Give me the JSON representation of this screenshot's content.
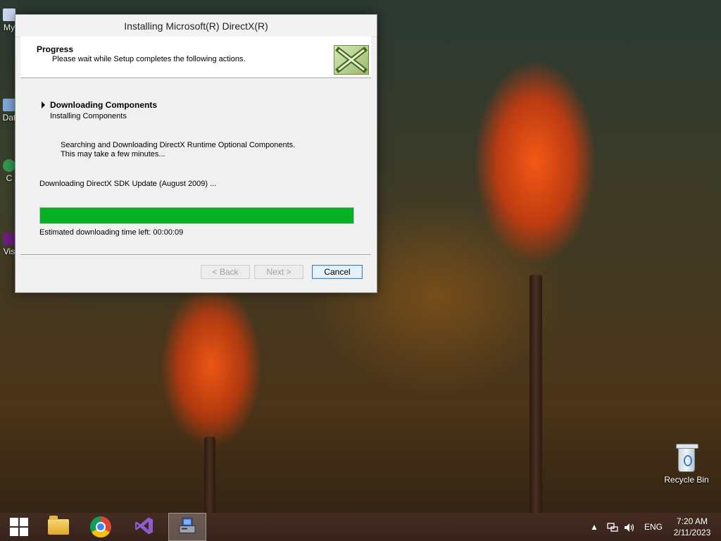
{
  "desktop": {
    "icons": [
      {
        "label": "My"
      },
      {
        "label": "Dat"
      },
      {
        "label": "C"
      },
      {
        "label": "Vis"
      }
    ],
    "recycle_bin_label": "Recycle Bin"
  },
  "dialog": {
    "title": "Installing Microsoft(R) DirectX(R)",
    "header_title": "Progress",
    "header_subtitle": "Please wait while Setup completes the following actions.",
    "step_title": "Downloading Components",
    "step_subtitle": "Installing Components",
    "detail_line1": "Searching and Downloading DirectX Runtime Optional Components.",
    "detail_line2": "This may take a few minutes...",
    "status": "Downloading DirectX SDK Update (August 2009) ...",
    "progress_percent": 100,
    "progress_color": "#06b025",
    "eta": "Estimated downloading time left: 00:00:09",
    "buttons": {
      "back": "< Back",
      "next": "Next >",
      "cancel": "Cancel"
    }
  },
  "taskbar": {
    "items": [
      "windows-start-icon",
      "file-explorer-icon",
      "chrome-icon",
      "visual-studio-icon",
      "setup-icon"
    ],
    "language": "ENG",
    "time": "7:20 AM",
    "date": "2/11/2023"
  }
}
